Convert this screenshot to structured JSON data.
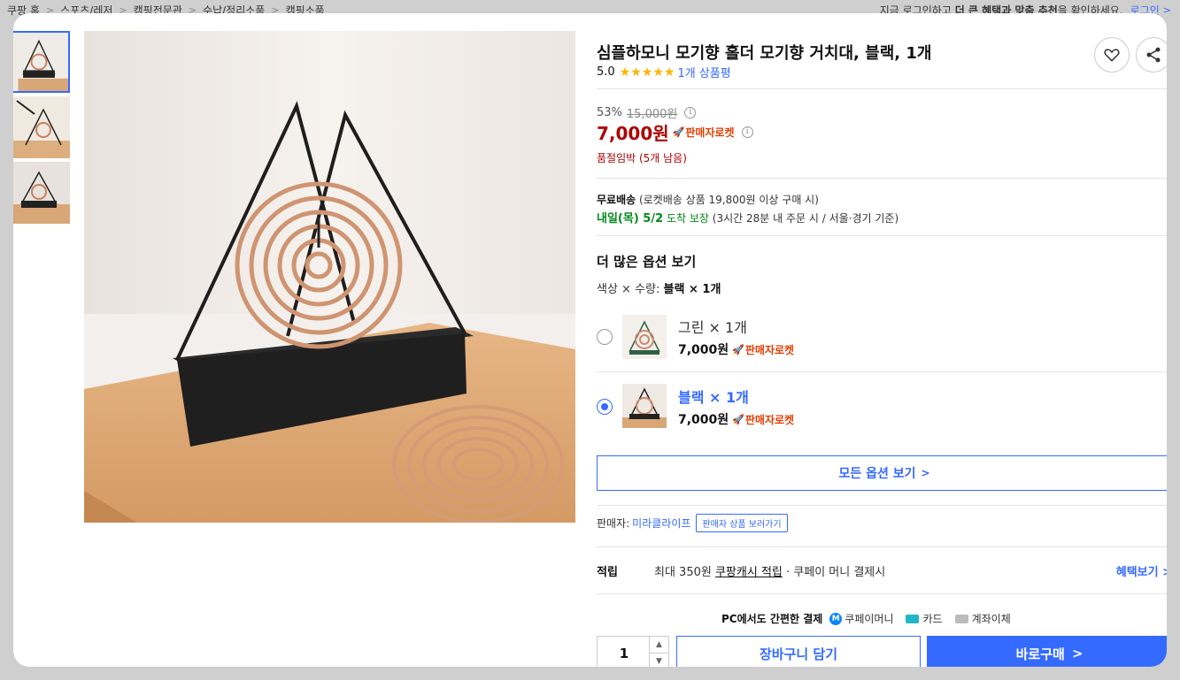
{
  "breadcrumb": [
    "쿠팡 홈",
    "스포츠/레저",
    "캠핑전문관",
    "수납/정리소품",
    "캠핑소품"
  ],
  "login_message": {
    "pre": "지금 로그인하고",
    "bold": "더 큰 혜택과 맞춤 추천",
    "post": "을 확인하세요.",
    "login": "로그인"
  },
  "product": {
    "title": "심플하모니 모기향 홀더 모기향 거치대, 블랙, 1개",
    "rating": "5.0",
    "stars": "★★★★★",
    "review_count": "1개 상품평",
    "discount_rate": "53%",
    "original_price": "15,000원",
    "price": "7,000원",
    "rocket_label": "판매자로켓",
    "stock_notice": "품절임박 (5개 남음)"
  },
  "shipping": {
    "free": "무료배송",
    "free_detail": "(로켓배송 상품 19,800원 이상 구매 시)",
    "arrival_day": "내일(목) 5/2",
    "arrival_label": "도착 보장",
    "arrival_detail": "(3시간 28분  내 주문 시 / 서울⋅경기 기준)"
  },
  "options": {
    "title": "더 많은 옵션 보기",
    "summary_prefix": "색상 × 수량:",
    "summary_value": "블랙 × 1개",
    "items": [
      {
        "name": "그린 × 1개",
        "price": "7,000원",
        "rocket": "판매자로켓",
        "selected": false
      },
      {
        "name": "블랙 × 1개",
        "price": "7,000원",
        "rocket": "판매자로켓",
        "selected": true
      }
    ],
    "all_button": "모든 옵션 보기"
  },
  "seller": {
    "label": "판매자:",
    "name": "미라클라이프",
    "button": "판매자 상품 보러가기"
  },
  "reward": {
    "label": "적립",
    "text_pre": "최대 350원",
    "text_link": "쿠팡캐시 적립",
    "text_post": "· 쿠페이 머니 결제시",
    "benefit": "혜택보기"
  },
  "payment": {
    "label": "PC에서도 간편한 결제",
    "methods": [
      "쿠페이머니",
      "카드",
      "계좌이체"
    ]
  },
  "purchase": {
    "quantity": "1",
    "cart_button": "장바구니 담기",
    "buy_button": "바로구매"
  },
  "colors": {
    "accent": "#346aff",
    "price_red": "#ae0000",
    "rocket_orange": "#e53e00",
    "arrival_green": "#00891a",
    "star": "#ffb400"
  }
}
